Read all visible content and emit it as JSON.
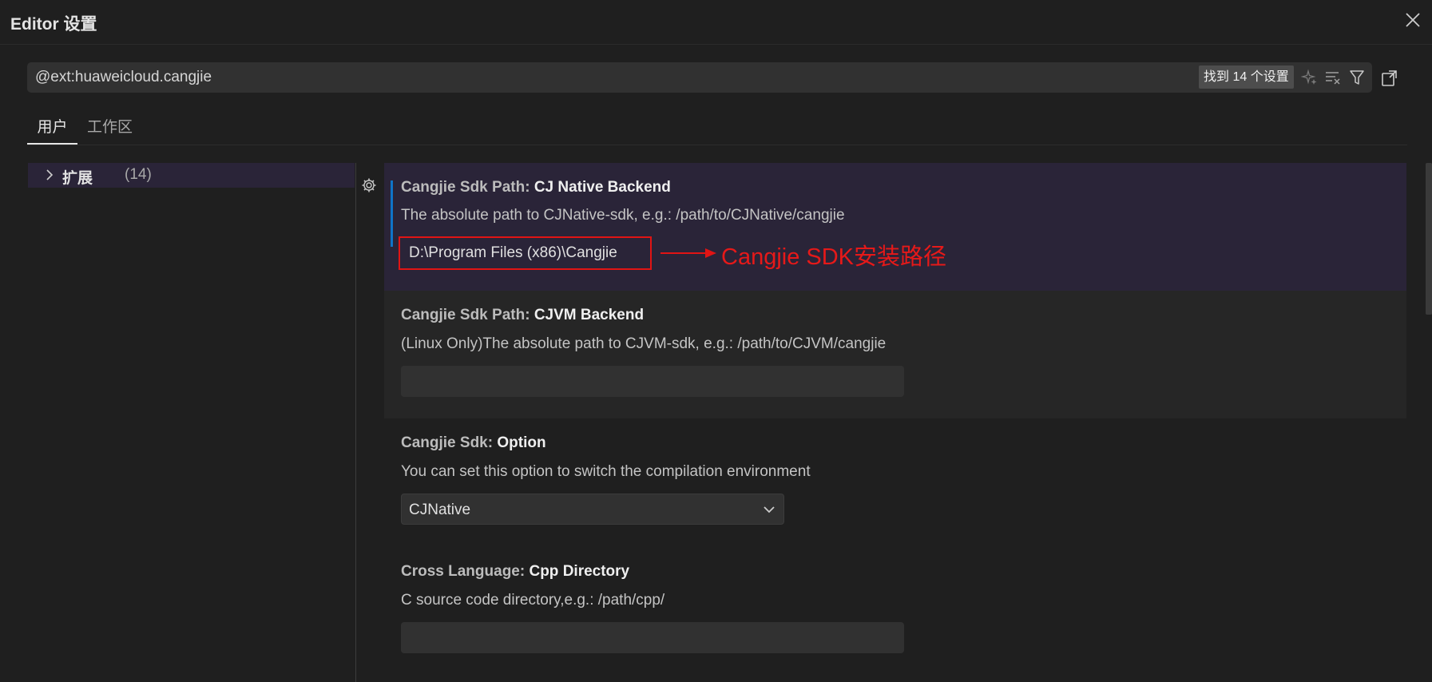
{
  "window": {
    "title": "Editor 设置",
    "close_icon": "close-icon"
  },
  "search": {
    "query": "@ext:huaweicloud.cangjie",
    "results_badge": "找到 14 个设置"
  },
  "tabs": [
    {
      "label": "用户",
      "active": true
    },
    {
      "label": "工作区",
      "active": false
    }
  ],
  "toc": {
    "label": "扩展",
    "count": "(14)"
  },
  "settings": [
    {
      "category": "Cangjie Sdk Path: ",
      "name": "CJ Native Backend",
      "description": "The absolute path to CJNative-sdk, e.g.: /path/to/CJNative/cangjie",
      "value": "D:\\Program Files (x86)\\Cangjie",
      "annotation": "Cangjie SDK安装路径"
    },
    {
      "category": "Cangjie Sdk Path: ",
      "name": "CJVM Backend",
      "description": "(Linux Only)The absolute path to CJVM-sdk, e.g.: /path/to/CJVM/cangjie",
      "value": ""
    },
    {
      "category": "Cangjie Sdk: ",
      "name": "Option",
      "description": "You can set this option to switch the compilation environment",
      "value": "CJNative"
    },
    {
      "category": "Cross Language: ",
      "name": "Cpp Directory",
      "description": "C source code directory,e.g.: /path/cpp/",
      "value": ""
    }
  ],
  "colors": {
    "accent": "#0f74c8",
    "annotation": "#e61919",
    "highlight_bg": "#2a2438"
  }
}
